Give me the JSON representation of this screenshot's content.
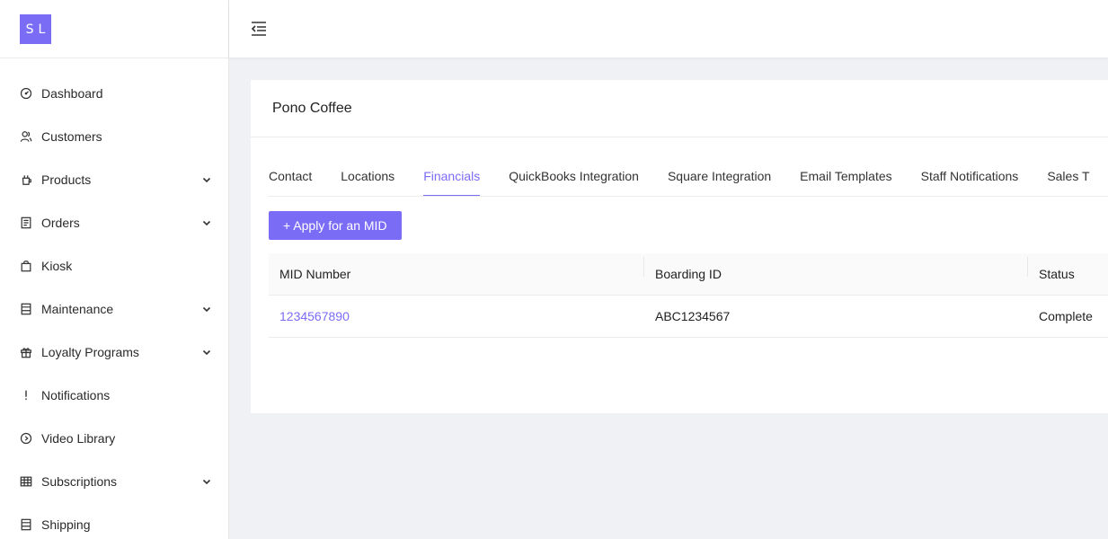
{
  "logo": {
    "text": "SL"
  },
  "sidebar": {
    "items": [
      {
        "label": "Dashboard",
        "icon": "dashboard-icon",
        "has_children": false
      },
      {
        "label": "Customers",
        "icon": "customers-icon",
        "has_children": false
      },
      {
        "label": "Products",
        "icon": "products-icon",
        "has_children": true
      },
      {
        "label": "Orders",
        "icon": "orders-icon",
        "has_children": true
      },
      {
        "label": "Kiosk",
        "icon": "kiosk-icon",
        "has_children": false
      },
      {
        "label": "Maintenance",
        "icon": "maintenance-icon",
        "has_children": true
      },
      {
        "label": "Loyalty Programs",
        "icon": "gift-icon",
        "has_children": true
      },
      {
        "label": "Notifications",
        "icon": "exclamation-icon",
        "has_children": false
      },
      {
        "label": "Video Library",
        "icon": "play-circle-icon",
        "has_children": false
      },
      {
        "label": "Subscriptions",
        "icon": "table-icon",
        "has_children": true
      },
      {
        "label": "Shipping",
        "icon": "shipping-icon",
        "has_children": false
      }
    ]
  },
  "header": {
    "toggle_icon": "menu-fold-icon"
  },
  "card": {
    "title": "Pono Coffee",
    "tabs": [
      {
        "label": "Contact",
        "active": false
      },
      {
        "label": "Locations",
        "active": false
      },
      {
        "label": "Financials",
        "active": true
      },
      {
        "label": "QuickBooks Integration",
        "active": false
      },
      {
        "label": "Square Integration",
        "active": false
      },
      {
        "label": "Email Templates",
        "active": false
      },
      {
        "label": "Staff Notifications",
        "active": false
      },
      {
        "label": "Sales T",
        "active": false
      }
    ],
    "apply_button": "+ Apply for an MID",
    "table": {
      "columns": [
        "MID Number",
        "Boarding ID",
        "Status"
      ],
      "rows": [
        {
          "mid": "1234567890",
          "boarding_id": "ABC1234567",
          "status": "Complete"
        }
      ]
    }
  },
  "colors": {
    "accent": "#7b6cf6",
    "background": "#f0f1f5"
  }
}
